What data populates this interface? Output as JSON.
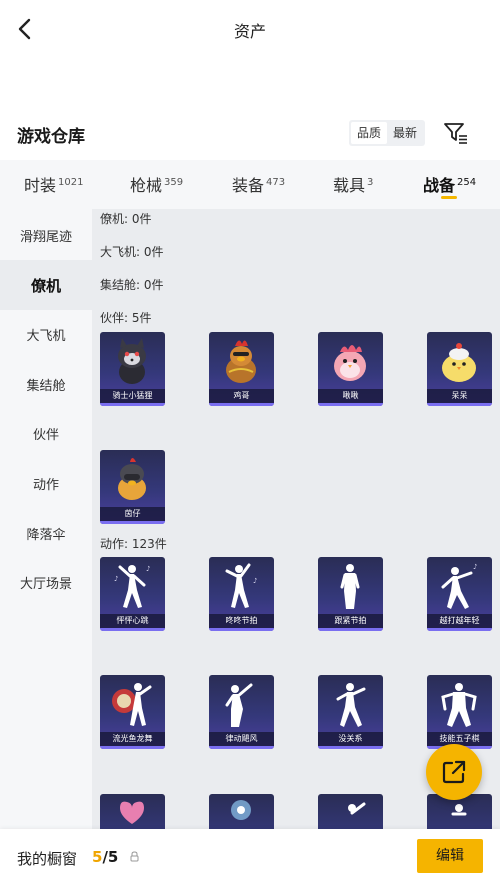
{
  "header": {
    "title": "资产"
  },
  "warehouse": {
    "title": "游戏仓库",
    "sort": {
      "quality_label": "品质",
      "latest_label": "最新"
    }
  },
  "tabs": [
    {
      "label": "时装",
      "count": "1021"
    },
    {
      "label": "枪械",
      "count": "359"
    },
    {
      "label": "装备",
      "count": "473"
    },
    {
      "label": "载具",
      "count": "3"
    },
    {
      "label": "战备",
      "count": "254"
    }
  ],
  "active_tab": "战备",
  "sidebar": {
    "items": [
      "滑翔尾迹",
      "僚机",
      "大飞机",
      "集结舱",
      "伙伴",
      "动作",
      "降落伞",
      "大厅场景"
    ],
    "active": "僚机"
  },
  "sections": {
    "wingman": "僚机: 0件",
    "big_plane": "大飞机: 0件",
    "capsule": "集结舱: 0件",
    "partner": "伙伴: 5件",
    "emote": "动作: 123件"
  },
  "partners": [
    {
      "name": "骑士小猛狸",
      "icon": "raccoon-icon"
    },
    {
      "name": "鸡哥",
      "icon": "rooster-icon"
    },
    {
      "name": "啾啾",
      "icon": "pink-chick-icon"
    },
    {
      "name": "呆呆",
      "icon": "yellow-chick-icon"
    },
    {
      "name": "茵仔",
      "icon": "helmet-chick-icon"
    }
  ],
  "emotes": [
    {
      "name": "怦怦心跳"
    },
    {
      "name": "咚咚节拍"
    },
    {
      "name": "跟紧节拍"
    },
    {
      "name": "越打越年轻"
    },
    {
      "name": "流光鱼龙舞"
    },
    {
      "name": "律动飓风"
    },
    {
      "name": "没关系"
    },
    {
      "name": "技能五子棋"
    },
    {
      "name": ""
    },
    {
      "name": ""
    },
    {
      "name": ""
    },
    {
      "name": ""
    }
  ],
  "bottom": {
    "label": "我的橱窗",
    "current": "5",
    "separator": "/",
    "total": "5",
    "edit_label": "编辑"
  },
  "colors": {
    "accent": "#f5b400",
    "card": "#34387a",
    "card_stripe": "#7a6ef0"
  }
}
